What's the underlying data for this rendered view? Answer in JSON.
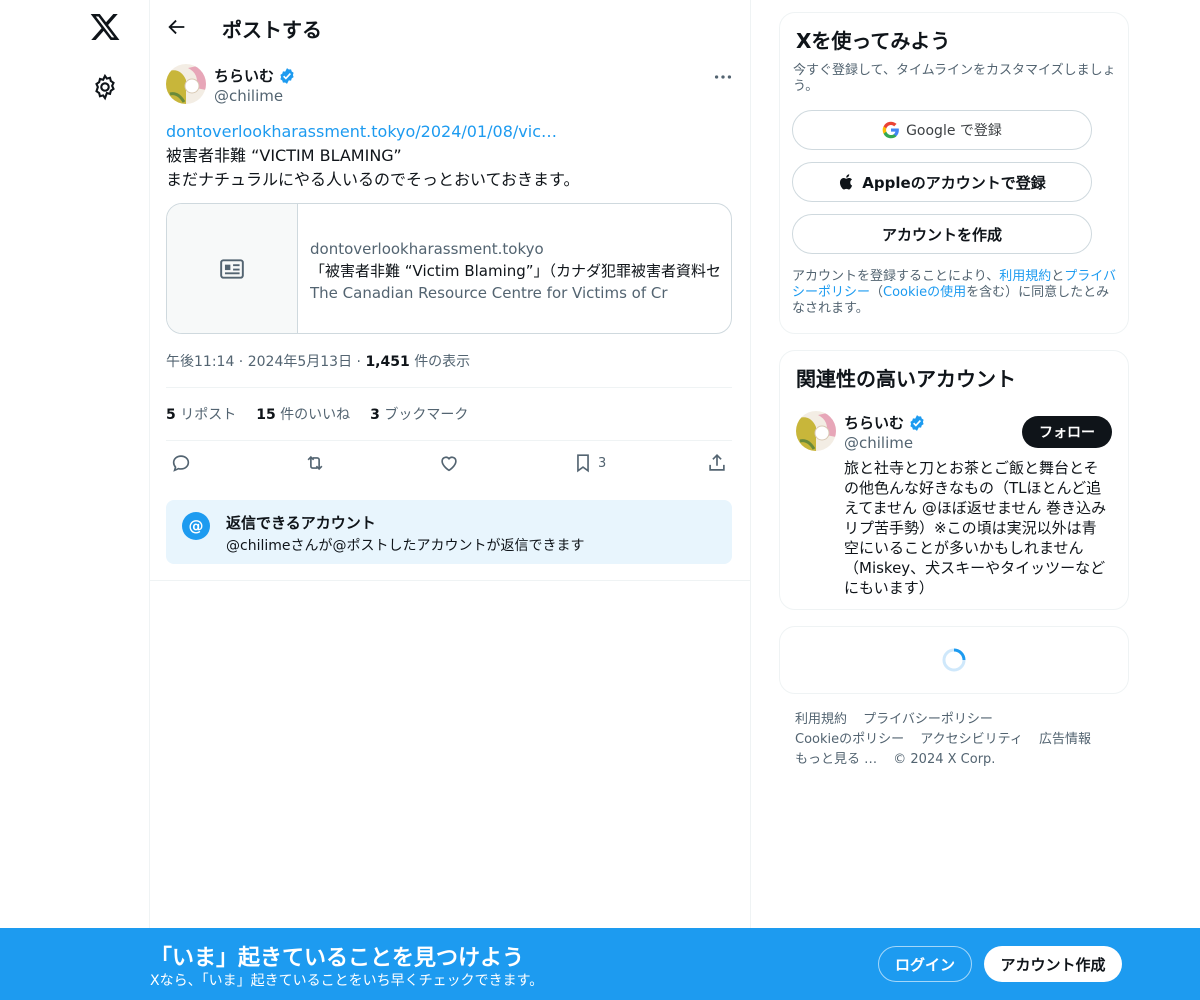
{
  "header": {
    "title": "ポストする"
  },
  "post": {
    "author_name": "ちらいむ",
    "author_handle": "@chilime",
    "link_text": "dontoverlookharassment.tokyo/2024/01/08/vic…",
    "line1": "被害者非難 “VICTIM BLAMING”",
    "line2": "まだナチュラルにやる人いるのでそっとおいておきます。",
    "card": {
      "domain": "dontoverlookharassment.tokyo",
      "title": "「被害者非難 “Victim Blaming”」（カナダ犯罪被害者資料セ",
      "description": "The Canadian Resource Centre for Victims of Cr"
    },
    "time": "午後11:14",
    "date": "2024年5月13日",
    "views_count": "1,451",
    "views_label": "件の表示",
    "reposts_count": "5",
    "reposts_label": "リポスト",
    "likes_count": "15",
    "likes_label": "件のいいね",
    "bookmarks_count": "3",
    "bookmarks_label": "ブックマーク",
    "bookmark_action_count": "3"
  },
  "reply_restriction": {
    "icon_text": "@",
    "title": "返信できるアカウント",
    "description": "@chilimeさんが@ポストしたアカウントが返信できます"
  },
  "signup": {
    "title": "Xを使ってみよう",
    "subtitle": "今すぐ登録して、タイムラインをカスタマイズしましょう。",
    "google_label": "Google で登録",
    "apple_label": "Appleのアカウントで登録",
    "create_label": "アカウントを作成",
    "terms_pre": "アカウントを登録することにより、",
    "terms_link": "利用規約",
    "terms_and": "と",
    "privacy_link": "プライバシーポリシー",
    "terms_mid": "（",
    "cookie_link": "Cookieの使用",
    "terms_post": "を含む）に同意したとみなされます。"
  },
  "related": {
    "title": "関連性の高いアカウント",
    "name": "ちらいむ",
    "handle": "@chilime",
    "follow_label": "フォロー",
    "bio": "旅と社寺と刀とお茶とご飯と舞台とその他色んな好きなもの（TLほとんど追えてません @ほぼ返せません 巻き込みリプ苦手勢）※この頃は実況以外は青空にいることが多いかもしれません（Miskey、犬スキーやタイッツーなどにもいます）"
  },
  "footer": {
    "terms": "利用規約",
    "privacy": "プライバシーポリシー",
    "cookie": "Cookieのポリシー",
    "accessibility": "アクセシビリティ",
    "ads": "広告情報",
    "more": "もっと見る …",
    "copyright": "© 2024 X Corp."
  },
  "bottom_bar": {
    "title": "「いま」起きていることを見つけよう",
    "subtitle": "Xなら、「いま」起きていることをいち早くチェックできます。",
    "login_label": "ログイン",
    "signup_label": "アカウント作成"
  },
  "colors": {
    "accent": "#1d9bf0",
    "text": "#0f1419",
    "secondary": "#536471"
  }
}
